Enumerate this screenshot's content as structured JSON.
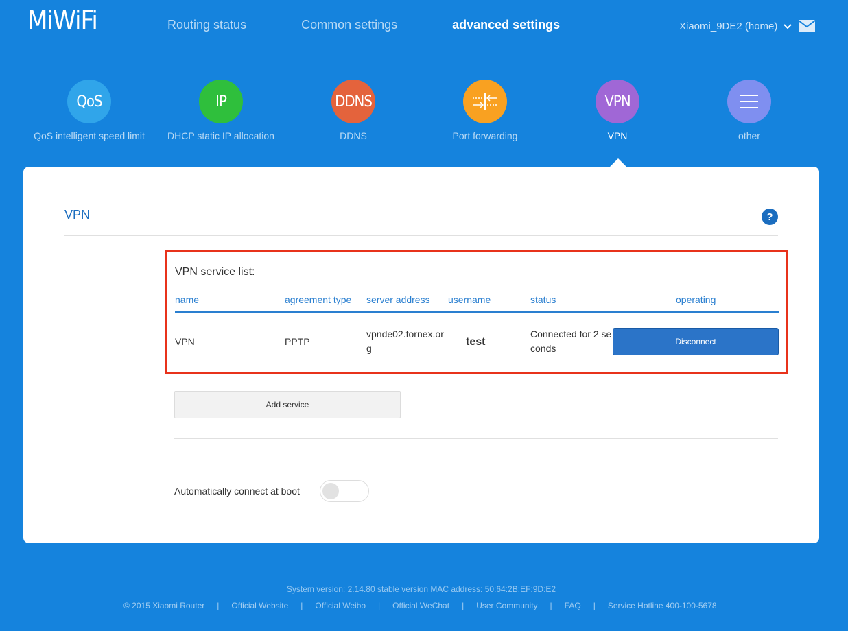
{
  "header": {
    "logo": "MiWiFi",
    "nav": [
      {
        "label": "Routing status",
        "active": false
      },
      {
        "label": "Common settings",
        "active": false
      },
      {
        "label": "advanced settings",
        "active": true
      }
    ],
    "router_name": "Xiaomi_9DE2 (home)"
  },
  "functions": [
    {
      "icon_text": "QoS",
      "label": "QoS intelligent speed limit",
      "color": "#30a5ea"
    },
    {
      "icon_text": "IP",
      "label": "DHCP static IP allocation",
      "color": "#2fbf3c"
    },
    {
      "icon_text": "DDNS",
      "label": "DDNS",
      "color": "#e4633c"
    },
    {
      "icon_text": "",
      "label": "Port forwarding",
      "color": "#f9a121"
    },
    {
      "icon_text": "VPN",
      "label": "VPN",
      "color": "#a067d6"
    },
    {
      "icon_text": "",
      "label": "other",
      "color": "#7f8ff0"
    }
  ],
  "panel": {
    "title": "VPN",
    "list_heading": "VPN service list:",
    "columns": [
      "name",
      "agreement type",
      "server address",
      "username",
      "status",
      "operating"
    ],
    "rows": [
      {
        "name": "VPN",
        "type": "PPTP",
        "server_line1": "vpnde02.fornex.or",
        "server_line2": "g",
        "username": "test",
        "status_line1": "Connected for 2 se",
        "status_line2": "conds",
        "action": "Disconnect"
      }
    ],
    "add_service": "Add service",
    "auto_connect_label": "Automatically connect at boot",
    "auto_connect_on": false
  },
  "footer": {
    "system_version": "System version: 2.14.80 stable version MAC address: 50:64:2B:EF:9D:E2",
    "copyright": "© 2015 Xiaomi Router",
    "links": [
      "Official Website",
      "Official Weibo",
      "Official WeChat",
      "User Community",
      "FAQ",
      "Service Hotline 400-100-5678"
    ]
  }
}
